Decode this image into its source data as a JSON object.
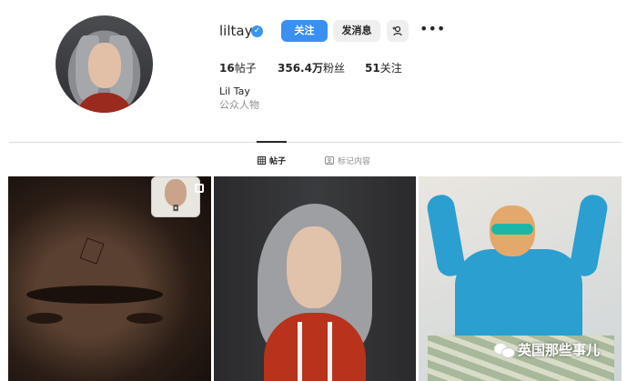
{
  "profile": {
    "username": "liltay",
    "verified_mark": "✓",
    "full_name": "Lil Tay",
    "category": "公众人物"
  },
  "actions": {
    "follow_label": "关注",
    "message_label": "发消息",
    "add_user_icon": "person-plus-icon",
    "more_label": "•••"
  },
  "stats": {
    "posts_count": "16",
    "posts_label": "帖子",
    "followers_count": "356.4万",
    "followers_label": "粉丝",
    "following_count": "51",
    "following_label": "关注"
  },
  "tabs": [
    {
      "label": "帖子",
      "icon": "grid-icon",
      "active": true
    },
    {
      "label": "标记内容",
      "icon": "tag-icon",
      "active": false
    }
  ],
  "watermark": {
    "text": "英国那些事儿",
    "icon": "wechat-icon"
  },
  "colors": {
    "accent": "#3a8ff0",
    "verified": "#3b94ee"
  }
}
